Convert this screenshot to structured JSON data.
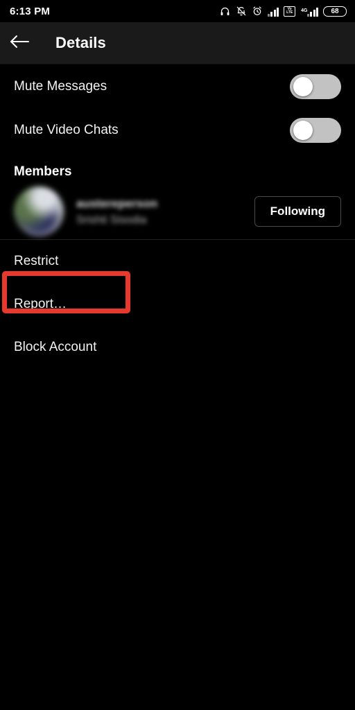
{
  "status_bar": {
    "time": "6:13 PM",
    "battery_percent": "68",
    "network_badge_top": "Vo",
    "network_badge_bottom": "LTE",
    "network_generation": "4G",
    "icons": [
      "headphones-icon",
      "bell-off-icon",
      "alarm-clock-icon",
      "signal-bars-icon",
      "volte-icon",
      "signal-bars-secondary-icon",
      "battery-icon"
    ]
  },
  "header": {
    "back_icon": "arrow-left-icon",
    "title": "Details"
  },
  "settings": [
    {
      "label": "Mute Messages",
      "toggle_state": "off"
    },
    {
      "label": "Mute Video Chats",
      "toggle_state": "off"
    }
  ],
  "members_section": {
    "title": "Members",
    "member": {
      "username": "austereperson",
      "display_name": "Srishti Sisodia",
      "action_label": "Following"
    }
  },
  "actions": [
    {
      "label": "Restrict",
      "highlighted": true
    },
    {
      "label": "Report…",
      "highlighted": false
    },
    {
      "label": "Block Account",
      "highlighted": false
    }
  ],
  "colors": {
    "background": "#000000",
    "header_background": "#1a1a1a",
    "text_primary": "#f2f2f2",
    "toggle_track": "#c2c2c2",
    "toggle_knob": "#ffffff",
    "highlight_red": "#e8392f",
    "divider": "#232323"
  }
}
